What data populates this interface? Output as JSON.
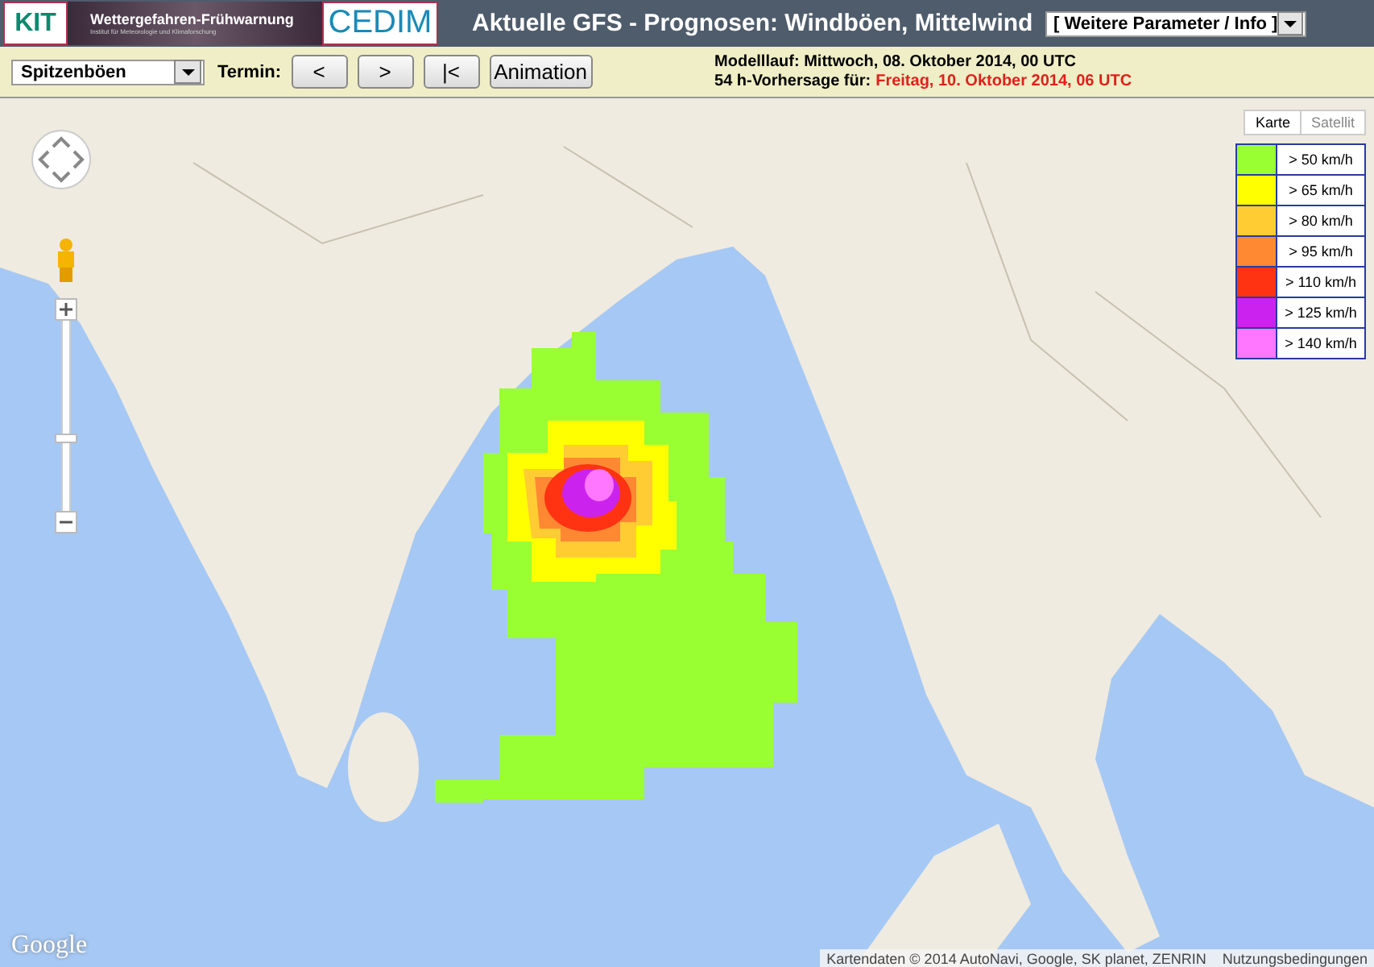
{
  "header": {
    "logos": {
      "kit": "KIT",
      "banner_title": "Wettergefahren-Frühwarnung",
      "banner_subtitle": "Institut für Meteorologie und Klimaforschung",
      "cedim": "CEDIM"
    },
    "title": "Aktuelle GFS - Prognosen: Windböen, Mittelwind",
    "parameter_select": "[ Weitere Parameter / Info ]"
  },
  "toolbar": {
    "variable_select": "Spitzenböen",
    "termin_label": "Termin:",
    "buttons": [
      "<",
      ">",
      "|<",
      "Animation"
    ],
    "model_run": "Modelllauf: Mittwoch, 08. Oktober 2014, 00 UTC",
    "forecast_label": "54 h-Vorhersage für:",
    "forecast_time": "Freitag, 10. Oktober 2014, 06 UTC"
  },
  "map": {
    "map_types": [
      {
        "label": "Karte",
        "selected": true
      },
      {
        "label": "Satellit",
        "selected": false
      }
    ],
    "legend": [
      {
        "label": "> 50 km/h",
        "color": "#99ff33"
      },
      {
        "label": "> 65 km/h",
        "color": "#ffff00"
      },
      {
        "label": "> 80 km/h",
        "color": "#ffcc33"
      },
      {
        "label": "> 95 km/h",
        "color": "#ff8833"
      },
      {
        "label": "> 110 km/h",
        "color": "#ff3311"
      },
      {
        "label": "> 125 km/h",
        "color": "#cc22ee"
      },
      {
        "label": "> 140 km/h",
        "color": "#ff77ff"
      }
    ],
    "zoom_slider": {
      "level": 0.36
    },
    "logo": "Google",
    "attribution": "Kartendaten © 2014 AutoNavi, Google, SK planet, ZENRIN",
    "terms": "Nutzungsbedingungen"
  }
}
